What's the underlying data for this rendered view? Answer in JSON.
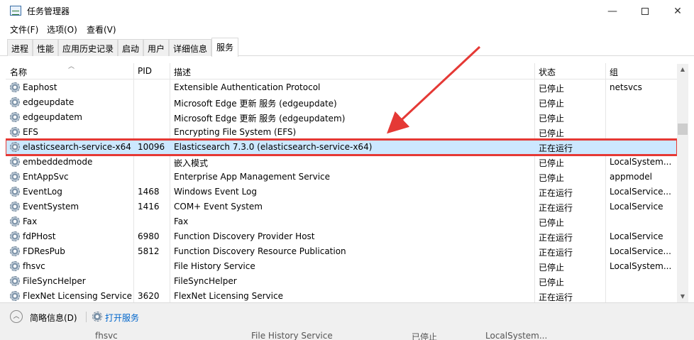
{
  "window": {
    "title": "任务管理器",
    "minimize": "—",
    "close": "✕"
  },
  "menu": [
    "文件(F)",
    "选项(O)",
    "查看(V)"
  ],
  "tabs": [
    "进程",
    "性能",
    "应用历史记录",
    "启动",
    "用户",
    "详细信息",
    "服务"
  ],
  "active_tab": "服务",
  "columns": {
    "name": "名称",
    "pid": "PID",
    "desc": "描述",
    "status": "状态",
    "group": "组"
  },
  "rows": [
    {
      "name": "Eaphost",
      "pid": "",
      "desc": "Extensible Authentication Protocol",
      "status": "已停止",
      "group": "netsvcs"
    },
    {
      "name": "edgeupdate",
      "pid": "",
      "desc": "Microsoft Edge 更新 服务 (edgeupdate)",
      "status": "已停止",
      "group": ""
    },
    {
      "name": "edgeupdatem",
      "pid": "",
      "desc": "Microsoft Edge 更新 服务 (edgeupdatem)",
      "status": "已停止",
      "group": ""
    },
    {
      "name": "EFS",
      "pid": "",
      "desc": "Encrypting File System (EFS)",
      "status": "已停止",
      "group": ""
    },
    {
      "name": "elasticsearch-service-x64",
      "pid": "10096",
      "desc": "Elasticsearch 7.3.0 (elasticsearch-service-x64)",
      "status": "正在运行",
      "group": ""
    },
    {
      "name": "embeddedmode",
      "pid": "",
      "desc": "嵌入模式",
      "status": "已停止",
      "group": "LocalSystem..."
    },
    {
      "name": "EntAppSvc",
      "pid": "",
      "desc": "Enterprise App Management Service",
      "status": "已停止",
      "group": "appmodel"
    },
    {
      "name": "EventLog",
      "pid": "1468",
      "desc": "Windows Event Log",
      "status": "正在运行",
      "group": "LocalService..."
    },
    {
      "name": "EventSystem",
      "pid": "1416",
      "desc": "COM+ Event System",
      "status": "正在运行",
      "group": "LocalService"
    },
    {
      "name": "Fax",
      "pid": "",
      "desc": "Fax",
      "status": "已停止",
      "group": ""
    },
    {
      "name": "fdPHost",
      "pid": "6980",
      "desc": "Function Discovery Provider Host",
      "status": "正在运行",
      "group": "LocalService"
    },
    {
      "name": "FDResPub",
      "pid": "5812",
      "desc": "Function Discovery Resource Publication",
      "status": "正在运行",
      "group": "LocalService..."
    },
    {
      "name": "fhsvc",
      "pid": "",
      "desc": "File History Service",
      "status": "已停止",
      "group": "LocalSystem..."
    },
    {
      "name": "FileSyncHelper",
      "pid": "",
      "desc": "FileSyncHelper",
      "status": "已停止",
      "group": ""
    },
    {
      "name": "FlexNet Licensing Service",
      "pid": "3620",
      "desc": "FlexNet Licensing Service",
      "status": "正在运行",
      "group": ""
    }
  ],
  "selected_row": "elasticsearch-service-x64",
  "footer": {
    "brief_label": "简略信息(D)",
    "open_services": "打开服务",
    "ghost": {
      "name": "fhsvc",
      "desc": "File History Service",
      "status": "已停止",
      "group": "LocalSystem..."
    }
  },
  "colors": {
    "highlight_box": "#e53935",
    "selected_row": "#cce8ff",
    "link": "#0066cc"
  }
}
